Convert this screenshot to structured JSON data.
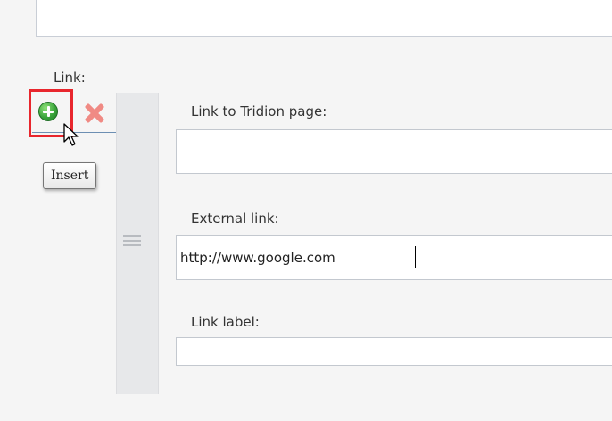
{
  "form": {
    "link_section_label": "Link:",
    "fields": [
      {
        "label": "Link to Tridion page:",
        "value": ""
      },
      {
        "label": "External link:",
        "value": "http://www.google.com"
      },
      {
        "label": "Link label:",
        "value": ""
      }
    ]
  },
  "toolbar": {
    "insert_icon": "add-circle-icon",
    "remove_icon": "remove-cross-icon",
    "insert_tooltip": "Insert",
    "highlight_color": "#e8262d"
  }
}
